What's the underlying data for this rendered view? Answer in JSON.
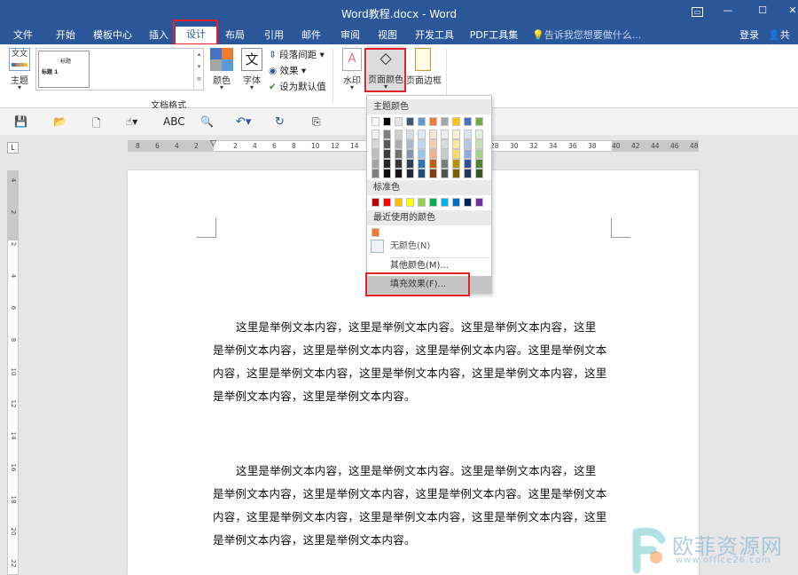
{
  "window": {
    "title": "Word教程.docx - Word"
  },
  "tabs": [
    "文件",
    "开始",
    "模板中心",
    "插入",
    "设计",
    "布局",
    "引用",
    "邮件",
    "审阅",
    "视图",
    "开发工具",
    "PDF工具集"
  ],
  "active_tab": "设计",
  "search_placeholder": "告诉我您想要做什么...",
  "account": {
    "login": "登录",
    "share": "共享"
  },
  "ribbon": {
    "theme_label": "主题",
    "style_preview_title": "标题",
    "style_preview_heading": "标题 1",
    "colors_label": "颜色",
    "fonts_label": "字体",
    "paragraph_spacing": "段落间距",
    "effects": "效果",
    "set_default": "设为默认值",
    "group_doc_format": "文档格式",
    "watermark": "水印",
    "page_color": "页面颜色",
    "page_borders": "页面边框"
  },
  "ruler_h_labels": [
    "8",
    "6",
    "4",
    "2",
    "2",
    "4",
    "6",
    "8",
    "10",
    "12",
    "14",
    "28",
    "30",
    "32",
    "34",
    "36",
    "38",
    "40",
    "42",
    "44",
    "46",
    "48"
  ],
  "ruler_v_labels": [
    "4",
    "2",
    "2",
    "4",
    "6",
    "8",
    "10",
    "12",
    "14",
    "16",
    "18",
    "20",
    "22"
  ],
  "dropdown": {
    "theme_colors_label": "主题颜色",
    "theme_colors": [
      "#ffffff",
      "#000000",
      "#e7e6e6",
      "#44546a",
      "#5b9bd5",
      "#ed7d31",
      "#a5a5a5",
      "#ffc000",
      "#4472c4",
      "#70ad47"
    ],
    "shade_rows": [
      [
        "#f2f2f2",
        "#7f7f7f",
        "#d0cece",
        "#d6dce4",
        "#deebf6",
        "#fbe5d5",
        "#ededed",
        "#fff2cc",
        "#dae3f3",
        "#e2efd9"
      ],
      [
        "#d8d8d8",
        "#595959",
        "#aeabab",
        "#adb9ca",
        "#bdd7ee",
        "#f7cbac",
        "#dbdbdb",
        "#fee599",
        "#b4c6e7",
        "#c5e0b3"
      ],
      [
        "#bfbfbf",
        "#3f3f3f",
        "#757070",
        "#8496b0",
        "#9cc3e5",
        "#f4b183",
        "#c9c9c9",
        "#ffd965",
        "#8eaadb",
        "#a8d08d"
      ],
      [
        "#a5a5a5",
        "#262626",
        "#3a3838",
        "#323f4f",
        "#2e75b5",
        "#c55a11",
        "#7b7b7b",
        "#bf9000",
        "#2f5496",
        "#538135"
      ],
      [
        "#7f7f7f",
        "#0c0c0c",
        "#171616",
        "#222a35",
        "#1e4e79",
        "#833c0b",
        "#525252",
        "#7f6000",
        "#1f3864",
        "#375623"
      ]
    ],
    "standard_colors_label": "标准色",
    "standard_colors": [
      "#c00000",
      "#ff0000",
      "#ffc000",
      "#ffff00",
      "#92d050",
      "#00b050",
      "#00b0f0",
      "#0070c0",
      "#002060",
      "#7030a0"
    ],
    "recent_colors_label": "最近使用的颜色",
    "recent_colors": [
      "#ed7d31"
    ],
    "no_color": "无颜色(N)",
    "more_colors": "其他颜色(M)...",
    "fill_effects": "填充效果(F)..."
  },
  "document": {
    "paragraph1": "这里是举例文本内容，这里是举例文本内容。这里是举例文本内容，这里是举例文本内容，这里是举例文本内容，这里是举例文本内容。这里是举例文本内容，这里是举例文本内容，这里是举例文本内容，这里是举例文本内容，这里是举例文本内容，这里是举例文本内容。",
    "paragraph2": "这里是举例文本内容，这里是举例文本内容。这里是举例文本内容，这里是举例文本内容，这里是举例文本内容，这里是举例文本内容。这里是举例文本内容，这里是举例文本内容，这里是举例文本内容，这里是举例文本内容，这里是举例文本内容，这里是举例文本内容。"
  },
  "watermark_logo": {
    "name": "欧菲资源网",
    "url": "www.office26.com"
  },
  "colors": {
    "accent": "#2b579a",
    "highlight": "#e8202a"
  }
}
